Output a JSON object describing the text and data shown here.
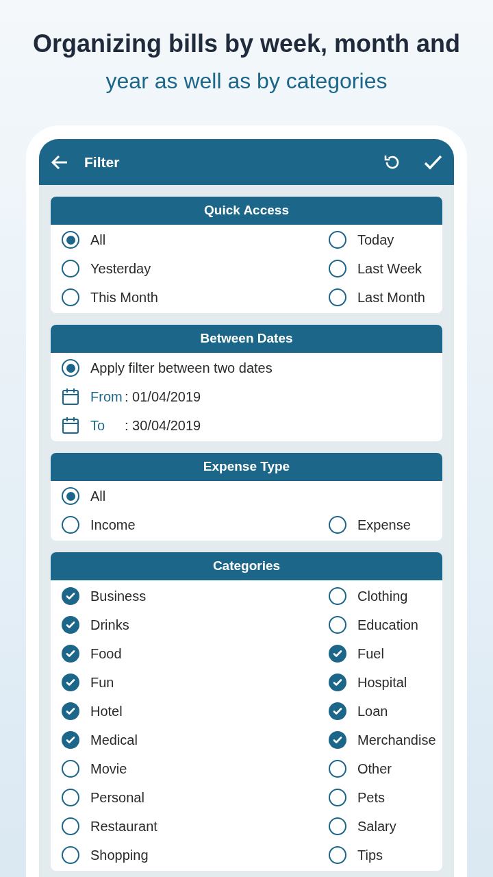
{
  "headline": {
    "line_1": "Organizing bills by week, month and",
    "line_2": "year as well as by categories"
  },
  "app_bar": {
    "title": "Filter"
  },
  "quick_access": {
    "title": "Quick Access",
    "options": [
      {
        "label": "All",
        "selected": true
      },
      {
        "label": "Today",
        "selected": false
      },
      {
        "label": "Yesterday",
        "selected": false
      },
      {
        "label": "Last Week",
        "selected": false
      },
      {
        "label": "This Month",
        "selected": false
      },
      {
        "label": "Last Month",
        "selected": false
      }
    ]
  },
  "between_dates": {
    "title": "Between Dates",
    "option": {
      "label": "Apply filter between two dates",
      "selected": true
    },
    "dates": [
      {
        "label": "From",
        "value": ": 01/04/2019"
      },
      {
        "label": "To",
        "value": ": 30/04/2019"
      }
    ]
  },
  "expense_type": {
    "title": "Expense Type",
    "options": [
      {
        "label": "All",
        "selected": true,
        "kind": "wide"
      },
      {
        "label": "Income",
        "selected": false,
        "kind": "half"
      },
      {
        "label": "Expense",
        "selected": false,
        "kind": "half"
      }
    ]
  },
  "categories": {
    "title": "Categories",
    "items": [
      {
        "label": "Business",
        "checked": true
      },
      {
        "label": "Clothing",
        "checked": false
      },
      {
        "label": "Drinks",
        "checked": true
      },
      {
        "label": "Education",
        "checked": false
      },
      {
        "label": "Food",
        "checked": true
      },
      {
        "label": "Fuel",
        "checked": true
      },
      {
        "label": "Fun",
        "checked": true
      },
      {
        "label": "Hospital",
        "checked": true
      },
      {
        "label": "Hotel",
        "checked": true
      },
      {
        "label": "Loan",
        "checked": true
      },
      {
        "label": "Medical",
        "checked": true
      },
      {
        "label": "Merchandise",
        "checked": true
      },
      {
        "label": "Movie",
        "checked": false
      },
      {
        "label": "Other",
        "checked": false
      },
      {
        "label": "Personal",
        "checked": false
      },
      {
        "label": "Pets",
        "checked": false
      },
      {
        "label": "Restaurant",
        "checked": false
      },
      {
        "label": "Salary",
        "checked": false
      },
      {
        "label": "Shopping",
        "checked": false
      },
      {
        "label": "Tips",
        "checked": false
      }
    ]
  }
}
